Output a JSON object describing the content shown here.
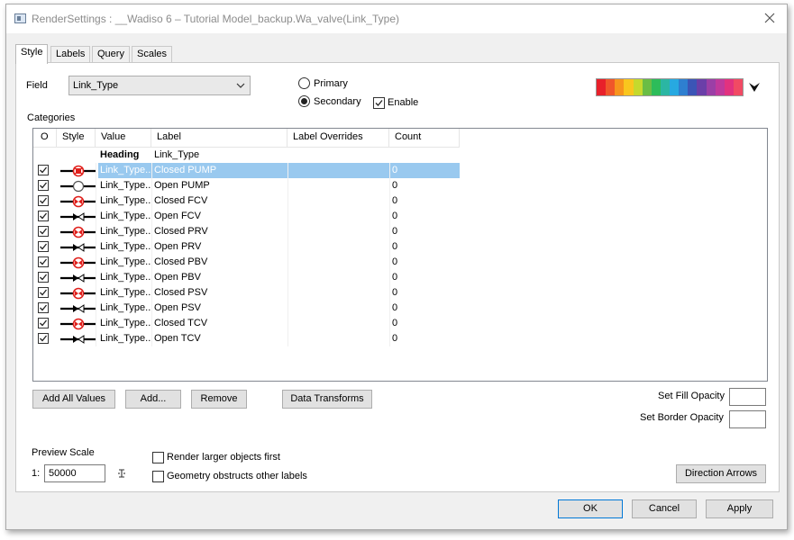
{
  "window": {
    "title": "RenderSettings : __Wadiso 6 – Tutorial Model_backup.Wa_valve(Link_Type)",
    "icon": "window-app-icon",
    "close_icon": "close-icon"
  },
  "tabs": [
    "Style",
    "Labels",
    "Query",
    "Scales"
  ],
  "field": {
    "label": "Field",
    "value": "Link_Type"
  },
  "mode": {
    "primary": "Primary",
    "secondary": "Secondary",
    "selected": "Secondary",
    "enable": "Enable",
    "enable_checked": true
  },
  "color_ramp": [
    "#e8202a",
    "#f0562a",
    "#f7941d",
    "#f9c61e",
    "#c5d92d",
    "#6abd45",
    "#2dbc5a",
    "#2bb6a3",
    "#27a9e1",
    "#2e7fd0",
    "#3b55b6",
    "#6a3fa8",
    "#9b3fa6",
    "#c0399c",
    "#e2327f",
    "#f14a64"
  ],
  "categories": {
    "label": "Categories",
    "columns": [
      "O",
      "Style",
      "Value",
      "Label",
      "Label Overrides",
      "Count"
    ],
    "heading": {
      "value": "Heading",
      "label": "Link_Type"
    },
    "rows": [
      {
        "checked": true,
        "symbol": "pump-closed",
        "value": "Link_Type...",
        "label": "Closed PUMP",
        "override": "",
        "count": "0",
        "selected": true
      },
      {
        "checked": true,
        "symbol": "pump-open",
        "value": "Link_Type...",
        "label": "Open PUMP",
        "override": "",
        "count": "0"
      },
      {
        "checked": true,
        "symbol": "valve-closed",
        "value": "Link_Type...",
        "label": "Closed FCV",
        "override": "",
        "count": "0"
      },
      {
        "checked": true,
        "symbol": "valve-open",
        "value": "Link_Type...",
        "label": "Open FCV",
        "override": "",
        "count": "0"
      },
      {
        "checked": true,
        "symbol": "valve-closed",
        "value": "Link_Type...",
        "label": "Closed PRV",
        "override": "",
        "count": "0"
      },
      {
        "checked": true,
        "symbol": "valve-open",
        "value": "Link_Type...",
        "label": "Open PRV",
        "override": "",
        "count": "0"
      },
      {
        "checked": true,
        "symbol": "valve-closed",
        "value": "Link_Type...",
        "label": "Closed PBV",
        "override": "",
        "count": "0"
      },
      {
        "checked": true,
        "symbol": "valve-open",
        "value": "Link_Type...",
        "label": "Open PBV",
        "override": "",
        "count": "0"
      },
      {
        "checked": true,
        "symbol": "valve-closed",
        "value": "Link_Type...",
        "label": "Closed PSV",
        "override": "",
        "count": "0"
      },
      {
        "checked": true,
        "symbol": "valve-open",
        "value": "Link_Type...",
        "label": "Open PSV",
        "override": "",
        "count": "0"
      },
      {
        "checked": true,
        "symbol": "valve-closed",
        "value": "Link_Type...",
        "label": "Closed TCV",
        "override": "",
        "count": "0"
      },
      {
        "checked": true,
        "symbol": "valve-open",
        "value": "Link_Type...",
        "label": "Open TCV",
        "override": "",
        "count": "0"
      }
    ]
  },
  "buttons": {
    "add_all": "Add All Values",
    "add": "Add...",
    "remove": "Remove",
    "data_transforms": "Data Transforms",
    "direction_arrows": "Direction Arrows",
    "ok": "OK",
    "cancel": "Cancel",
    "apply": "Apply"
  },
  "opacity": {
    "fill": "Set Fill Opacity",
    "border": "Set Border Opacity",
    "fill_value": "",
    "border_value": ""
  },
  "preview": {
    "label": "Preview Scale",
    "prefix": "1:",
    "value": "50000",
    "icon": "scale-lock-icon"
  },
  "options": {
    "render_larger": "Render larger objects first",
    "geometry_obstructs": "Geometry obstructs other labels",
    "render_larger_checked": false,
    "geometry_obstructs_checked": false
  }
}
